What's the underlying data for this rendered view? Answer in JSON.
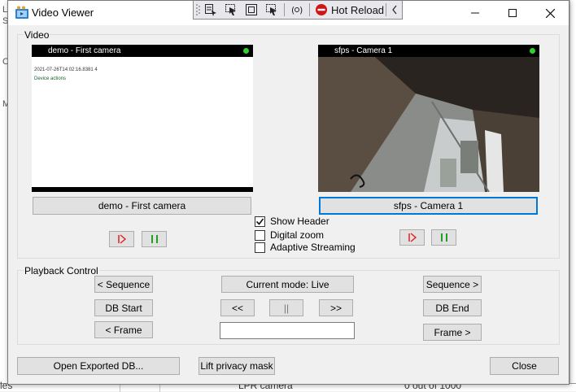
{
  "dialog": {
    "title": "Video Viewer"
  },
  "toolbar": {
    "hot_reload_label": "Hot Reload"
  },
  "video_group": {
    "title": "Video",
    "camera_left": {
      "header_name": "demo - First camera",
      "timestamp": "2021-07-26T14:02:16.8381 4",
      "device_actions": "Device actions",
      "select_button": "demo - First camera"
    },
    "camera_right": {
      "header_name": "sfps - Camera 1",
      "select_button": "sfps - Camera 1"
    },
    "options": [
      {
        "label": "Show Header",
        "checked": true
      },
      {
        "label": "Digital zoom",
        "checked": false
      },
      {
        "label": "Adaptive Streaming",
        "checked": false
      }
    ]
  },
  "playback": {
    "title": "Playback Control",
    "prev_sequence": "< Sequence",
    "current_mode": "Current mode: Live",
    "next_sequence": "Sequence >",
    "db_start": "DB Start",
    "step_back": "<<",
    "pause": "||",
    "step_forward": ">>",
    "db_end": "DB End",
    "prev_frame": "< Frame",
    "time_value": "",
    "next_frame": "Frame >"
  },
  "footer": {
    "open_exported_db": "Open Exported DB...",
    "lift_privacy_mask": "Lift privacy mask",
    "close": "Close"
  },
  "background": {
    "left_fragments": [
      "L",
      "S",
      "C",
      "M"
    ],
    "bottom_fragments": [
      "les",
      "LPR camera",
      "0 out of 1000"
    ]
  },
  "colors": {
    "accent": "#0078d7",
    "status_online": "#2bd42b",
    "play_icon": "#e02020",
    "pause_icon": "#20a020",
    "stop_icon": "#d01515"
  },
  "icons": {
    "app": "video-viewer-icon",
    "minimize": "minimize-icon",
    "maximize": "maximize-icon",
    "close": "close-icon"
  }
}
